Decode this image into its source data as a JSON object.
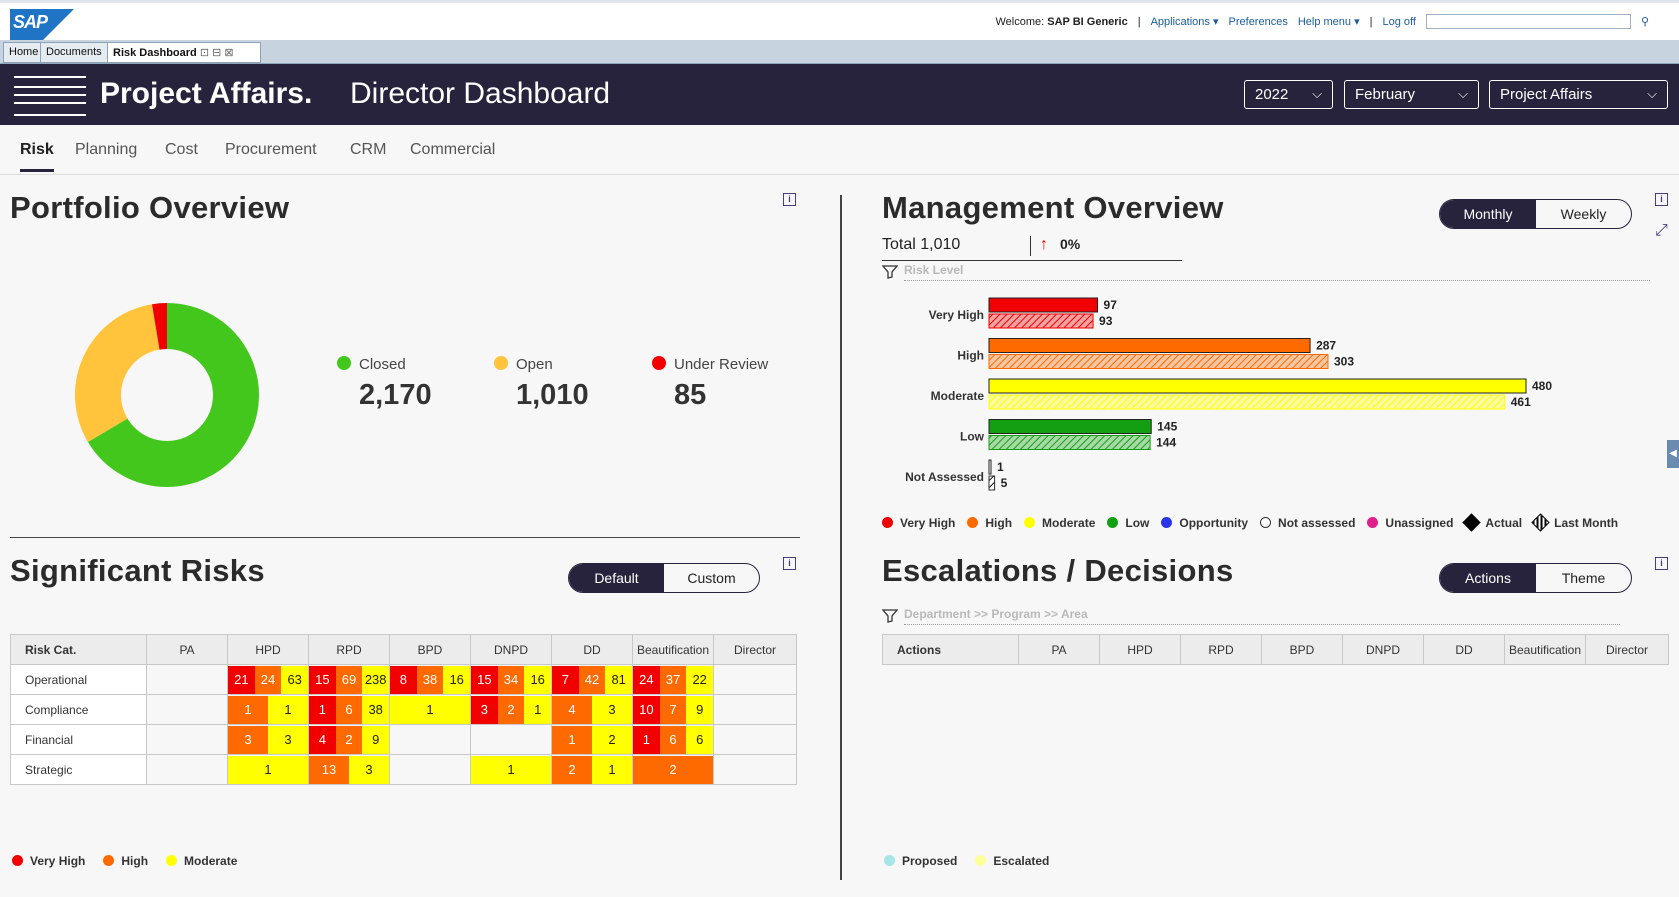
{
  "topbar": {
    "logo": "SAP",
    "welcome_prefix": "Welcome:",
    "welcome_user": "SAP BI Generic",
    "applications": "Applications",
    "preferences": "Preferences",
    "help": "Help menu",
    "logoff": "Log off"
  },
  "doc_tabs": [
    "Home",
    "Documents",
    "Risk Dashboard"
  ],
  "header": {
    "title_bold": "Project Affairs.",
    "title_light": "Director Dashboard",
    "year": "2022",
    "month": "February",
    "org": "Project Affairs"
  },
  "nav": [
    "Risk",
    "Planning",
    "Cost",
    "Procurement",
    "CRM",
    "Commercial"
  ],
  "portfolio": {
    "title": "Portfolio Overview",
    "items": [
      {
        "label": "Closed",
        "value": "2,170",
        "color": "#44c71c"
      },
      {
        "label": "Open",
        "value": "1,010",
        "color": "#ffc33c"
      },
      {
        "label": "Under Review",
        "value": "85",
        "color": "#f20000"
      }
    ]
  },
  "significant": {
    "title": "Significant Risks",
    "toggle": [
      "Default",
      "Custom"
    ],
    "columns": [
      "Risk Cat.",
      "PA",
      "HPD",
      "RPD",
      "BPD",
      "DNPD",
      "DD",
      "Beautification",
      "Director"
    ],
    "rows": [
      {
        "label": "Operational",
        "cells": [
          [],
          [
            [
              "vh",
              "21"
            ],
            [
              "hi",
              "24"
            ],
            [
              "mo",
              "63"
            ]
          ],
          [
            [
              "vh",
              "15"
            ],
            [
              "hi",
              "69"
            ],
            [
              "mo",
              "238"
            ]
          ],
          [
            [
              "vh",
              "8"
            ],
            [
              "hi",
              "38"
            ],
            [
              "mo",
              "16"
            ]
          ],
          [
            [
              "vh",
              "15"
            ],
            [
              "hi",
              "34"
            ],
            [
              "mo",
              "16"
            ]
          ],
          [
            [
              "vh",
              "7"
            ],
            [
              "hi",
              "42"
            ],
            [
              "mo",
              "81"
            ]
          ],
          [
            [
              "vh",
              "24"
            ],
            [
              "hi",
              "37"
            ],
            [
              "mo",
              "22"
            ]
          ],
          []
        ]
      },
      {
        "label": "Compliance",
        "cells": [
          [],
          [
            [
              "hi",
              "1"
            ],
            [
              "mo",
              "1"
            ]
          ],
          [
            [
              "vh",
              "1"
            ],
            [
              "hi",
              "6"
            ],
            [
              "mo",
              "38"
            ]
          ],
          [
            [
              "mo",
              "1"
            ]
          ],
          [
            [
              "vh",
              "3"
            ],
            [
              "hi",
              "2"
            ],
            [
              "mo",
              "1"
            ]
          ],
          [
            [
              "hi",
              "4"
            ],
            [
              "mo",
              "3"
            ]
          ],
          [
            [
              "vh",
              "10"
            ],
            [
              "hi",
              "7"
            ],
            [
              "mo",
              "9"
            ]
          ],
          []
        ]
      },
      {
        "label": "Financial",
        "cells": [
          [],
          [
            [
              "hi",
              "3"
            ],
            [
              "mo",
              "3"
            ]
          ],
          [
            [
              "vh",
              "4"
            ],
            [
              "hi",
              "2"
            ],
            [
              "mo",
              "9"
            ]
          ],
          [],
          [],
          [
            [
              "hi",
              "1"
            ],
            [
              "mo",
              "2"
            ]
          ],
          [
            [
              "vh",
              "1"
            ],
            [
              "hi",
              "6"
            ],
            [
              "mo",
              "6"
            ]
          ],
          []
        ]
      },
      {
        "label": "Strategic",
        "cells": [
          [],
          [
            [
              "mo",
              "1"
            ]
          ],
          [
            [
              "hi",
              "13"
            ],
            [
              "mo",
              "3"
            ]
          ],
          [],
          [
            [
              "mo",
              "1"
            ]
          ],
          [
            [
              "hi",
              "2"
            ],
            [
              "mo",
              "1"
            ]
          ],
          [
            [
              "hi",
              "2"
            ]
          ],
          []
        ]
      }
    ],
    "legend": [
      {
        "label": "Very High",
        "color": "#f20000"
      },
      {
        "label": "High",
        "color": "#ff6a00"
      },
      {
        "label": "Moderate",
        "color": "#ffff00"
      }
    ]
  },
  "management": {
    "title": "Management Overview",
    "toggle": [
      "Monthly",
      "Weekly"
    ],
    "total": "Total 1,010",
    "change": "0%",
    "filter_label": "Risk Level",
    "legend": [
      {
        "label": "Very High",
        "color": "#f20000"
      },
      {
        "label": "High",
        "color": "#ff6a00"
      },
      {
        "label": "Moderate",
        "color": "#ffff00"
      },
      {
        "label": "Low",
        "color": "#12a012"
      },
      {
        "label": "Opportunity",
        "color": "#2a35e8"
      },
      {
        "label": "Not assessed",
        "color": "#ffffff"
      },
      {
        "label": "Unassigned",
        "color": "#e0208a"
      },
      {
        "label": "Actual",
        "color": "#000000"
      },
      {
        "label": "Last Month",
        "color": "#000000"
      }
    ]
  },
  "escalations": {
    "title": "Escalations / Decisions",
    "toggle": [
      "Actions",
      "Theme"
    ],
    "filter_label": "Department >> Program >> Area",
    "columns": [
      "Actions",
      "PA",
      "HPD",
      "RPD",
      "BPD",
      "DNPD",
      "DD",
      "Beautification",
      "Director"
    ],
    "legend": [
      {
        "label": "Proposed",
        "color": "#a6e6e6"
      },
      {
        "label": "Escalated",
        "color": "#ffff99"
      }
    ]
  },
  "chart_data": [
    {
      "type": "pie",
      "title": "Portfolio Overview",
      "categories": [
        "Closed",
        "Open",
        "Under Review"
      ],
      "values": [
        2170,
        1010,
        85
      ],
      "colors": [
        "#44c71c",
        "#ffc33c",
        "#f20000"
      ]
    },
    {
      "type": "bar",
      "orientation": "horizontal",
      "categories": [
        "Very High",
        "High",
        "Moderate",
        "Low",
        "Not Assessed"
      ],
      "series": [
        {
          "name": "Actual",
          "values": [
            97,
            287,
            480,
            145,
            1
          ]
        },
        {
          "name": "Last Month",
          "values": [
            93,
            303,
            461,
            144,
            5
          ]
        }
      ],
      "colors": [
        "#f20000",
        "#ff6a00",
        "#ffff00",
        "#12a012",
        "#ffffff"
      ],
      "xlim": [
        0,
        480
      ]
    }
  ]
}
